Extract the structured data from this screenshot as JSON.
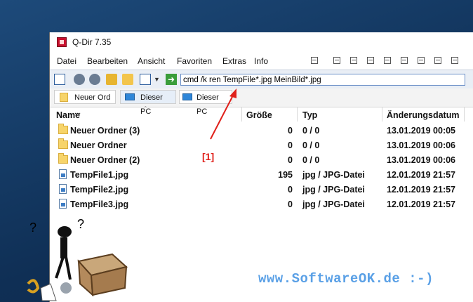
{
  "window": {
    "title": "Q-Dir 7.35"
  },
  "menu": [
    "Datei",
    "Bearbeiten",
    "Ansicht",
    "Favoriten",
    "Extras",
    "Info"
  ],
  "toolbar": {
    "command_value": "cmd /k ren TempFile*.jpg MeinBild*.jpg"
  },
  "tabs": [
    {
      "label": "Neuer Ord ..."
    },
    {
      "label": "Dieser PC"
    },
    {
      "label": "Dieser PC"
    }
  ],
  "table": {
    "headers": [
      "Name",
      "Größe",
      "Typ",
      "Änderungsdatum"
    ],
    "rows": [
      {
        "name": "Neuer Ordner (3)",
        "size": "0",
        "type": "0 / 0",
        "date": "13.01.2019 00:05",
        "icon": "folder-icon"
      },
      {
        "name": "Neuer Ordner",
        "size": "0",
        "type": "0 / 0",
        "date": "13.01.2019 00:06",
        "icon": "folder-icon"
      },
      {
        "name": "Neuer Ordner (2)",
        "size": "0",
        "type": "0 / 0",
        "date": "13.01.2019 00:06",
        "icon": "folder-icon"
      },
      {
        "name": "TempFile1.jpg",
        "size": "195",
        "type": "jpg / JPG-Datei",
        "date": "12.01.2019 21:57",
        "icon": "image-file-icon"
      },
      {
        "name": "TempFile2.jpg",
        "size": "0",
        "type": "jpg / JPG-Datei",
        "date": "12.01.2019 21:57",
        "icon": "image-file-icon"
      },
      {
        "name": "TempFile3.jpg",
        "size": "0",
        "type": "jpg / JPG-Datei",
        "date": "12.01.2019 21:57",
        "icon": "image-file-icon"
      }
    ]
  },
  "annotation": {
    "label": "[1]"
  },
  "footer": {
    "text": "www.SoftwareOK.de :-)"
  },
  "colors": {
    "annotation": "#e0201a",
    "footer": "#5aa0e6",
    "folder": "#f7d46a"
  }
}
